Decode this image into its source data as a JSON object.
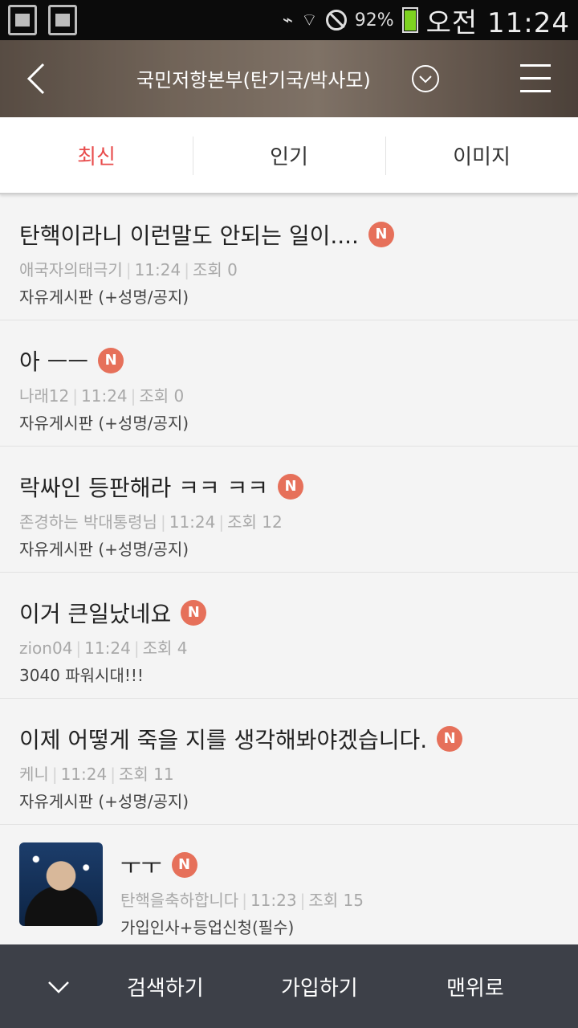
{
  "status_bar": {
    "battery": "92%",
    "time": "오전 11:24"
  },
  "header": {
    "title": "국민저항본부(탄기국/박사모)",
    "icons": {
      "back": "back-arrow-icon",
      "dropdown": "chevron-down-circle-icon",
      "menu": "hamburger-menu-icon"
    }
  },
  "tabs": [
    {
      "label": "최신",
      "active": true
    },
    {
      "label": "인기",
      "active": false
    },
    {
      "label": "이미지",
      "active": false
    }
  ],
  "posts": [
    {
      "title": "탄핵이라니 이런말도 안되는 일이....",
      "badge": "N",
      "author": "애국자의태극기",
      "time": "11:24",
      "views": "조회 0",
      "board": "자유게시판 (+성명/공지)"
    },
    {
      "title": "아 ㅡㅡ",
      "badge": "N",
      "author": "나래12",
      "time": "11:24",
      "views": "조회 0",
      "board": "자유게시판 (+성명/공지)"
    },
    {
      "title": "락싸인 등판해라 ㅋㅋ ㅋㅋ",
      "badge": "N",
      "author": "존경하는 박대통령님",
      "time": "11:24",
      "views": "조회 12",
      "board": "자유게시판 (+성명/공지)"
    },
    {
      "title": "이거 큰일났네요",
      "badge": "N",
      "author": "zion04",
      "time": "11:24",
      "views": "조회 4",
      "board": "3040 파워시대!!!"
    },
    {
      "title": "이제 어떻게 죽을 지를 생각해봐야겠습니다.",
      "badge": "N",
      "author": "케니",
      "time": "11:24",
      "views": "조회 11",
      "board": "자유게시판 (+성명/공지)"
    },
    {
      "title": "ㅜㅜ",
      "badge": "N",
      "author": "탄핵을축하합니다",
      "time": "11:23",
      "views": "조회 15",
      "board": "가입인사+등업신청(필수)"
    }
  ],
  "bottom_bar": {
    "search": "검색하기",
    "join": "가입하기",
    "top": "맨위로"
  }
}
